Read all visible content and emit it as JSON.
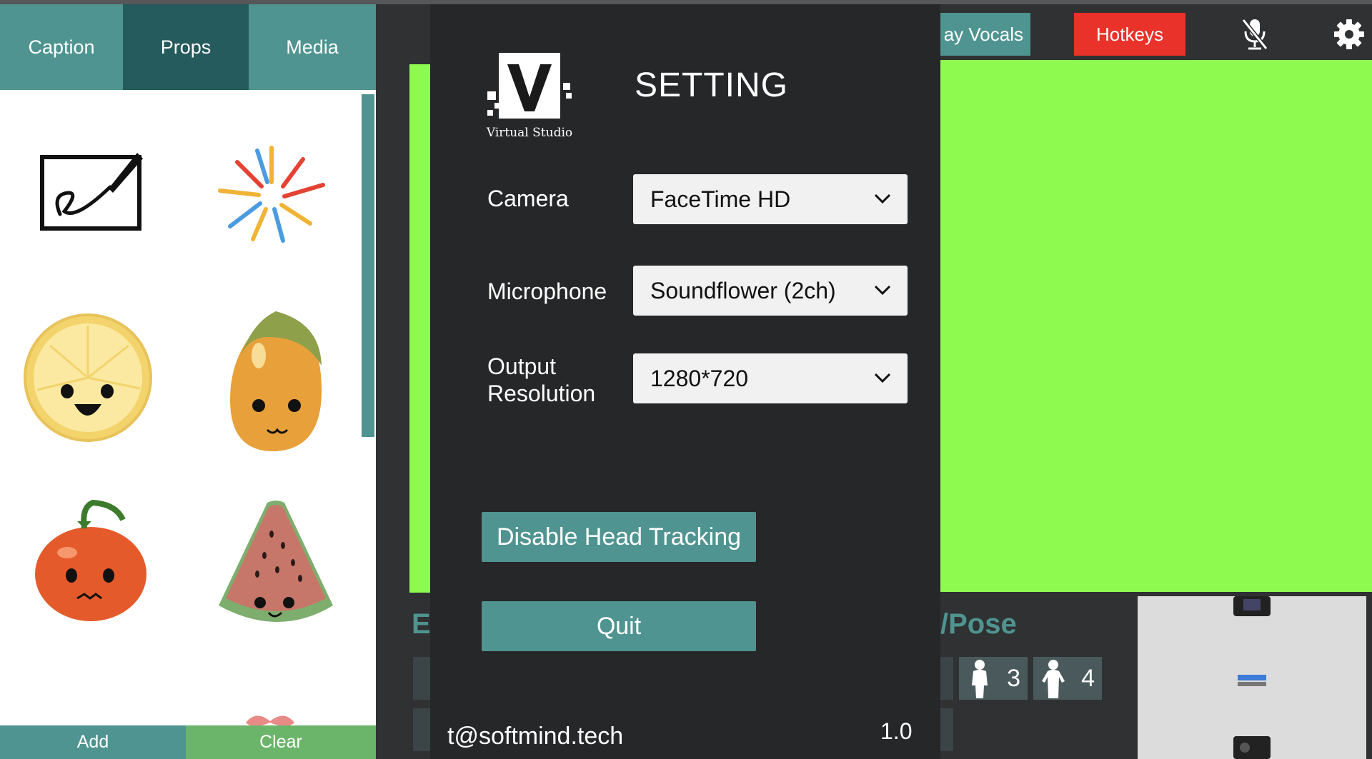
{
  "left_panel": {
    "tabs": [
      {
        "label": "Caption",
        "active": false
      },
      {
        "label": "Props",
        "active": true
      },
      {
        "label": "Media",
        "active": false
      }
    ],
    "props": [
      {
        "name": "signature-board-icon"
      },
      {
        "name": "fireworks-icon"
      },
      {
        "name": "lemon-face-icon"
      },
      {
        "name": "mango-face-icon"
      },
      {
        "name": "tomato-face-icon"
      },
      {
        "name": "watermelon-face-icon"
      },
      {
        "name": "bow-icon"
      }
    ],
    "add_label": "Add",
    "clear_label": "Clear"
  },
  "topbar": {
    "vocals_label": "ay Vocals",
    "hotkeys_label": "Hotkeys",
    "mic_icon": "mic-muted-icon",
    "settings_icon": "gear-icon"
  },
  "bottom": {
    "e_label": "E",
    "pose_label": "Pose",
    "pose_buttons": [
      "3",
      "4"
    ]
  },
  "dialog": {
    "logo_letter": "V",
    "logo_caption": "Virtual Studio",
    "title": "SETTING",
    "camera": {
      "label": "Camera",
      "value": "FaceTime HD"
    },
    "microphone": {
      "label": "Microphone",
      "value": "Soundflower (2ch)"
    },
    "resolution": {
      "label_line1": "Output",
      "label_line2": "Resolution",
      "value": "1280*720"
    },
    "head_tracking_label": "Disable Head Tracking",
    "quit_label": "Quit",
    "email": "t@softmind.tech",
    "version": "1.0"
  },
  "colors": {
    "teal": "#4f9490",
    "teal_dark": "#255b5c",
    "green_screen": "#8ef94f",
    "hotkeys_red": "#e8322a",
    "dialog_bg": "#262728"
  }
}
